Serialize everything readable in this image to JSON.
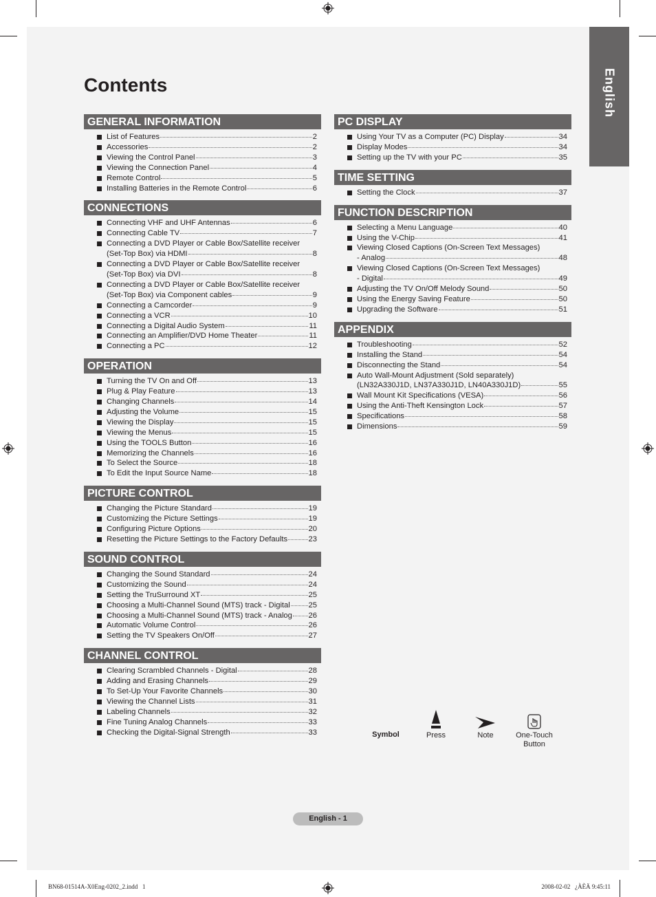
{
  "page": {
    "title": "Contents",
    "language_tab": "English",
    "page_number": "English - 1"
  },
  "columns": {
    "left": [
      {
        "heading": "GENERAL INFORMATION",
        "items": [
          {
            "lines": [
              "List of Features"
            ],
            "page": "2"
          },
          {
            "lines": [
              "Accessories"
            ],
            "page": "2"
          },
          {
            "lines": [
              "Viewing the Control Panel"
            ],
            "page": "3"
          },
          {
            "lines": [
              "Viewing the Connection Panel"
            ],
            "page": "4"
          },
          {
            "lines": [
              "Remote Control"
            ],
            "page": "5"
          },
          {
            "lines": [
              "Installing Batteries in the Remote Control"
            ],
            "page": "6"
          }
        ]
      },
      {
        "heading": "CONNECTIONS",
        "items": [
          {
            "lines": [
              "Connecting VHF and UHF Antennas"
            ],
            "page": "6"
          },
          {
            "lines": [
              "Connecting Cable TV"
            ],
            "page": "7"
          },
          {
            "lines": [
              "Connecting a DVD Player or Cable Box/Satellite receiver",
              "(Set-Top Box) via HDMI"
            ],
            "page": "8"
          },
          {
            "lines": [
              "Connecting a DVD Player or Cable Box/Satellite receiver",
              "(Set-Top Box) via DVI"
            ],
            "page": "8"
          },
          {
            "lines": [
              "Connecting a DVD Player or Cable Box/Satellite receiver",
              "(Set-Top Box) via Component cables"
            ],
            "page": "9"
          },
          {
            "lines": [
              "Connecting a Camcorder"
            ],
            "page": "9"
          },
          {
            "lines": [
              "Connecting a VCR"
            ],
            "page": "10"
          },
          {
            "lines": [
              "Connecting a Digital Audio System"
            ],
            "page": "11"
          },
          {
            "lines": [
              "Connecting an Amplifier/DVD Home Theater"
            ],
            "page": "11"
          },
          {
            "lines": [
              "Connecting a PC"
            ],
            "page": "12"
          }
        ]
      },
      {
        "heading": "OPERATION",
        "items": [
          {
            "lines": [
              "Turning the TV On and Off"
            ],
            "page": "13"
          },
          {
            "lines": [
              "Plug & Play Feature"
            ],
            "page": "13"
          },
          {
            "lines": [
              "Changing Channels"
            ],
            "page": "14"
          },
          {
            "lines": [
              "Adjusting the Volume"
            ],
            "page": "15"
          },
          {
            "lines": [
              "Viewing the Display"
            ],
            "page": "15"
          },
          {
            "lines": [
              "Viewing the Menus"
            ],
            "page": "15"
          },
          {
            "lines": [
              "Using the TOOLS Button"
            ],
            "page": "16"
          },
          {
            "lines": [
              "Memorizing the Channels"
            ],
            "page": "16"
          },
          {
            "lines": [
              "To Select the Source"
            ],
            "page": "18"
          },
          {
            "lines": [
              "To Edit the Input Source Name"
            ],
            "page": "18"
          }
        ]
      },
      {
        "heading": "PICTURE CONTROL",
        "items": [
          {
            "lines": [
              "Changing the Picture Standard"
            ],
            "page": "19"
          },
          {
            "lines": [
              "Customizing the Picture Settings"
            ],
            "page": "19"
          },
          {
            "lines": [
              "Configuring Picture Options"
            ],
            "page": "20"
          },
          {
            "lines": [
              "Resetting the Picture Settings to the Factory Defaults"
            ],
            "page": "23"
          }
        ]
      },
      {
        "heading": "SOUND CONTROL",
        "items": [
          {
            "lines": [
              "Changing the Sound Standard"
            ],
            "page": "24"
          },
          {
            "lines": [
              "Customizing the Sound"
            ],
            "page": "24"
          },
          {
            "lines": [
              "Setting the TruSurround XT"
            ],
            "page": "25"
          },
          {
            "lines": [
              "Choosing a Multi-Channel Sound (MTS) track - Digital"
            ],
            "page": "25"
          },
          {
            "lines": [
              "Choosing a Multi-Channel Sound (MTS) track - Analog"
            ],
            "page": "26"
          },
          {
            "lines": [
              "Automatic Volume Control"
            ],
            "page": "26"
          },
          {
            "lines": [
              "Setting the TV Speakers On/Off"
            ],
            "page": "27"
          }
        ]
      },
      {
        "heading": "CHANNEL CONTROL",
        "items": [
          {
            "lines": [
              "Clearing Scrambled Channels - Digital"
            ],
            "page": "28"
          },
          {
            "lines": [
              "Adding and Erasing Channels"
            ],
            "page": "29"
          },
          {
            "lines": [
              "To Set-Up Your Favorite Channels"
            ],
            "page": "30"
          },
          {
            "lines": [
              "Viewing the Channel Lists"
            ],
            "page": "31"
          },
          {
            "lines": [
              "Labeling Channels"
            ],
            "page": "32"
          },
          {
            "lines": [
              "Fine Tuning Analog Channels"
            ],
            "page": "33"
          },
          {
            "lines": [
              "Checking the Digital-Signal Strength"
            ],
            "page": "33"
          }
        ]
      }
    ],
    "right": [
      {
        "heading": "PC DISPLAY",
        "items": [
          {
            "lines": [
              "Using Your TV as a Computer (PC) Display"
            ],
            "page": "34"
          },
          {
            "lines": [
              "Display Modes"
            ],
            "page": "34"
          },
          {
            "lines": [
              "Setting up the TV with your PC"
            ],
            "page": "35"
          }
        ]
      },
      {
        "heading": "TIME SETTING",
        "items": [
          {
            "lines": [
              "Setting the Clock"
            ],
            "page": "37"
          }
        ]
      },
      {
        "heading": "FUNCTION DESCRIPTION",
        "items": [
          {
            "lines": [
              "Selecting a Menu Language"
            ],
            "page": "40"
          },
          {
            "lines": [
              "Using the V-Chip"
            ],
            "page": "41"
          },
          {
            "lines": [
              "Viewing Closed Captions (On-Screen Text Messages)",
              "- Analog"
            ],
            "page": "48"
          },
          {
            "lines": [
              "Viewing Closed Captions (On-Screen Text Messages)",
              "- Digital"
            ],
            "page": "49"
          },
          {
            "lines": [
              "Adjusting the TV On/Off Melody Sound"
            ],
            "page": "50"
          },
          {
            "lines": [
              "Using the Energy Saving Feature"
            ],
            "page": "50"
          },
          {
            "lines": [
              "Upgrading the Software"
            ],
            "page": "51"
          }
        ]
      },
      {
        "heading": "APPENDIX",
        "items": [
          {
            "lines": [
              "Troubleshooting"
            ],
            "page": "52"
          },
          {
            "lines": [
              "Installing the Stand"
            ],
            "page": "54"
          },
          {
            "lines": [
              "Disconnecting the Stand"
            ],
            "page": "54"
          },
          {
            "lines": [
              "Auto Wall-Mount Adjustment (Sold separately)",
              "(LN32A330J1D, LN37A330J1D, LN40A330J1D)"
            ],
            "page": "55"
          },
          {
            "lines": [
              "Wall Mount Kit Specifications (VESA)"
            ],
            "page": "56"
          },
          {
            "lines": [
              "Using the Anti-Theft Kensington Lock"
            ],
            "page": "57"
          },
          {
            "lines": [
              "Specifications"
            ],
            "page": "58"
          },
          {
            "lines": [
              "Dimensions"
            ],
            "page": "59"
          }
        ]
      }
    ]
  },
  "legend": {
    "symbol_label": "Symbol",
    "items": [
      {
        "icon": "press-icon",
        "label": "Press"
      },
      {
        "icon": "note-icon",
        "label": "Note"
      },
      {
        "icon": "one-touch-button-icon",
        "label": "One-Touch\nButton"
      }
    ]
  },
  "print_footer": {
    "filename": "BN68-01514A-X0Eng-0202_2.indd   1",
    "timestamp": "2008-02-02   ¿ÀÈÄ 9:45:11"
  },
  "colors": {
    "header_bg": "#676565",
    "page_bg": "#f3f3f3",
    "pill_bg": "#bcbcbc",
    "text": "#231f20"
  }
}
